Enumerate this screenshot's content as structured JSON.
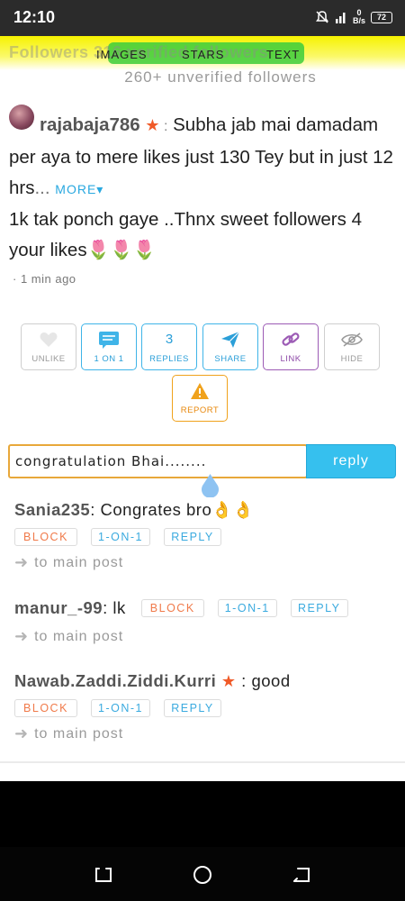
{
  "status_bar": {
    "time": "12:10",
    "net_speed_value": "0",
    "net_speed_unit": "B/s",
    "battery": "72",
    "icons": [
      "notification-muted-icon",
      "signal-icon",
      "battery-icon"
    ]
  },
  "header": {
    "faded_text": "Followers  316 verified followers",
    "unverified_count": "260+ unverified followers",
    "tabs": [
      {
        "label": "IMAGES"
      },
      {
        "label": "STARS"
      },
      {
        "label": "TEXT"
      }
    ]
  },
  "post": {
    "username": "rajabaja786",
    "star": "★",
    "separator": " :",
    "text_part1": " Subha jab mai damadam per aya to mere likes just 130 Tey but in just 12 hrs",
    "ellipsis": "...",
    "more_label": "MORE▾",
    "text_part2": "1k tak ponch gaye ..Thnx sweet followers 4 your likes🌷🌷🌷",
    "timestamp": "· 1 min ago"
  },
  "actions": {
    "unlike": "UNLIKE",
    "one_on_one": "1 ON 1",
    "replies_count": "3",
    "replies": "REPLIES",
    "share": "SHARE",
    "link": "LINK",
    "hide": "HIDE",
    "report": "REPORT"
  },
  "reply_box": {
    "value": "congratulation Bhai........",
    "button": "reply"
  },
  "comments": [
    {
      "username": "Sania235",
      "separator": ": ",
      "text": "Congrates bro👌👌",
      "has_star": false
    },
    {
      "username": "manur_-99",
      "separator": ": ",
      "text": "lk",
      "has_star": false
    },
    {
      "username": "Nawab.Zaddi.Ziddi.Kurri",
      "separator": " : ",
      "text": "good",
      "has_star": true
    }
  ],
  "comment_chips": {
    "block": "BLOCK",
    "one_on_one": "1-ON-1",
    "reply": "REPLY",
    "to_main": "to main post"
  },
  "colors": {
    "accent_blue": "#36c0ee",
    "report_orange": "#f0a21c",
    "block_orange": "#f07a4a",
    "link_purple": "#9c5bb5",
    "header_yellow": "#f6f200"
  }
}
